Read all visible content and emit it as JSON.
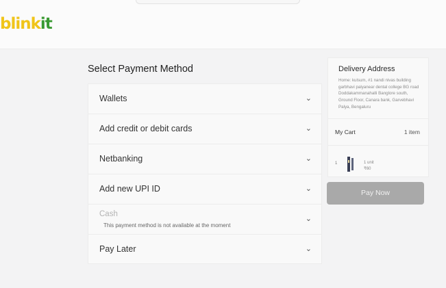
{
  "brand": {
    "logo_part1": "blink",
    "logo_part2": "it"
  },
  "payment": {
    "title": "Select Payment Method",
    "methods": [
      {
        "label": "Wallets"
      },
      {
        "label": "Add credit or debit cards"
      },
      {
        "label": "Netbanking"
      },
      {
        "label": "Add new UPI ID"
      },
      {
        "label": "Cash",
        "note": "This payment method is not available at the moment"
      },
      {
        "label": "Pay Later"
      }
    ]
  },
  "delivery": {
    "title": "Delivery Address",
    "address": "Home: kulsum, #1 nandi nivas building garbhavi palyanear dental college BG road Doddakammanahalli Banglore south, Ground Floor, Canara bank, Garvebhavi Palya, Bengaluru"
  },
  "cart": {
    "title": "My Cart",
    "count": "1 item",
    "item": {
      "qty": "1",
      "unit": "1 unit",
      "price": "₹60"
    }
  },
  "actions": {
    "pay_now": "Pay Now"
  },
  "colors": {
    "logo_yellow": "#f0c419",
    "logo_green": "#3a9a32",
    "pay_button_disabled": "#a9a9a9"
  }
}
